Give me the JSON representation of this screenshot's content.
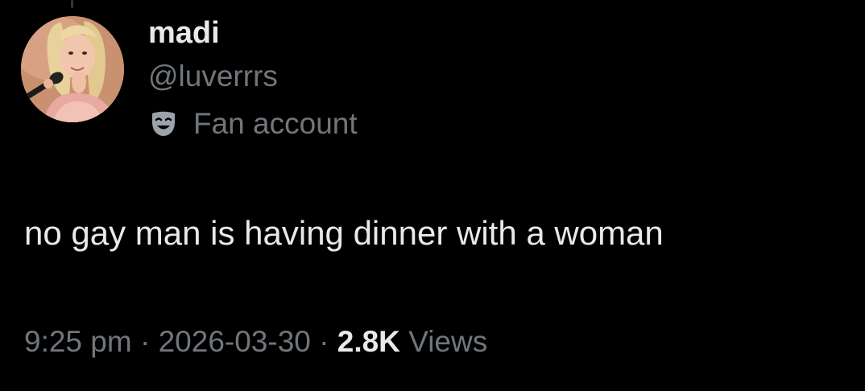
{
  "user": {
    "display_name": "madi",
    "handle": "@luverrrs",
    "label": "Fan account",
    "label_icon": "theater-masks-icon",
    "avatar": "profile-photo"
  },
  "tweet": {
    "text": "no gay man is having dinner with a woman"
  },
  "meta": {
    "time": "9:25 pm",
    "separator": "·",
    "date": "2026-03-30",
    "views_count": "2.8K",
    "views_label": "Views"
  },
  "colors": {
    "background": "#000000",
    "primary_text": "#e7e9ea",
    "secondary_text": "#71767b"
  }
}
